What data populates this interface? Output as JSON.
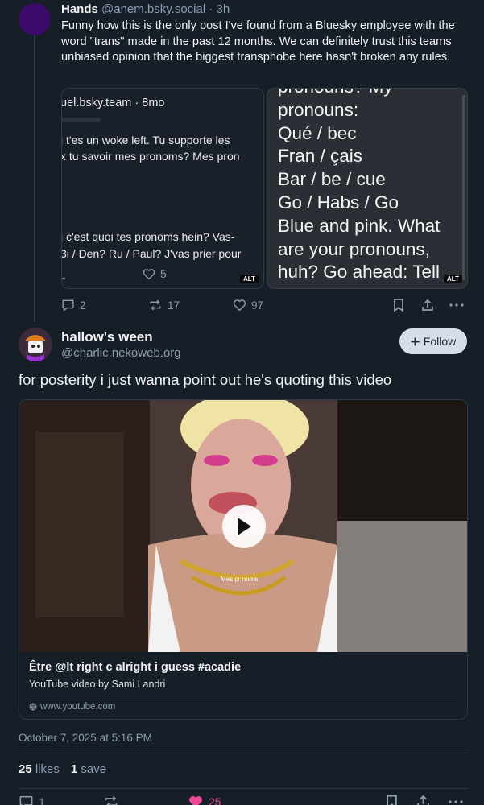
{
  "parent_post": {
    "author_name": "Hands",
    "author_handle": "@anem.bsky.social",
    "time": "· 3h",
    "text": "Funny how this is the only post I've found from a Bluesky employee with the word \"trans\" made in the past 12 months. We can definitely trust this teams unbiased opinion that the biggest transphobe here hasn't broken any rules.",
    "image1": {
      "header": "uel.bsky.team · 8mo",
      "line1": "i t'es un woke left. Tu supporte les",
      "line2": "x tu savoir mes pronoms? Mes pron",
      "line3": "i c'est quoi tes pronoms hein? Vas-",
      "line4": "3i / Den? Ru / Paul? J'vas prier pour",
      "likes": "5",
      "alt": "ALT"
    },
    "image2": {
      "lines": [
        "pronouns? My",
        "pronouns:",
        "Qué / bec",
        "Fran / çais",
        "Bar / be / cue",
        "Go / Habs / Go",
        "Blue and pink. What",
        "are your pronouns,",
        "huh? Go ahead: Tell"
      ],
      "alt": "ALT"
    },
    "replies": "2",
    "reposts": "17",
    "likes": "97"
  },
  "post": {
    "author_name": "hallow's ween",
    "author_handle": "@charlic.nekoweb.org",
    "follow_label": "Follow",
    "text": "for posterity i just wanna point out he's quoting this video",
    "embed": {
      "title": "Être @lt right c alright i guess #acadie",
      "description": "YouTube video by Sami Landri",
      "domain": "www.youtube.com",
      "thumb_caption": "Mes pr noms"
    },
    "date": "October 7, 2025 at 5:16 PM",
    "stats": {
      "likes_count": "25",
      "likes_label": "likes",
      "saves_count": "1",
      "saves_label": "save"
    },
    "replies": "1",
    "likes": "25"
  },
  "colors": {
    "background": "#161e27",
    "muted": "#8d9cb0",
    "like_active": "#ec4899"
  }
}
